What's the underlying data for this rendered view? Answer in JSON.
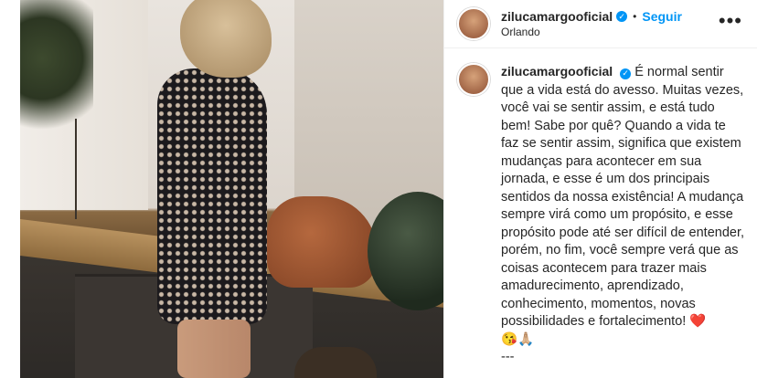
{
  "post": {
    "author": {
      "username": "zilucamargooficial",
      "verified": true,
      "follow_label": "Seguir",
      "separator": "•",
      "location": "Orlando"
    },
    "more_label": "•••",
    "caption": {
      "username": "zilucamargooficial",
      "text": "É normal sentir que a vida está do avesso. Muitas vezes, você vai se sentir assim, e está tudo bem! Sabe por quê? Quando a vida te faz se sentir assim, significa que existem mudanças para acontecer em sua jornada, e esse é um dos principais sentidos da nossa existência! A mudança sempre virá como um propósito, e esse propósito pode até ser difícil de entender, porém, no fim, você sempre verá que as coisas acontecem para trazer mais amadurecimento, aprendizado, conhecimento, momentos, novas possibilidades e fortalecimento! ",
      "emoji_heart": "❤️",
      "emoji_rest": "😘🙏🏼",
      "trailing": "---"
    }
  },
  "colors": {
    "link_blue": "#0095f6",
    "text": "#262626",
    "border": "#efefef"
  }
}
